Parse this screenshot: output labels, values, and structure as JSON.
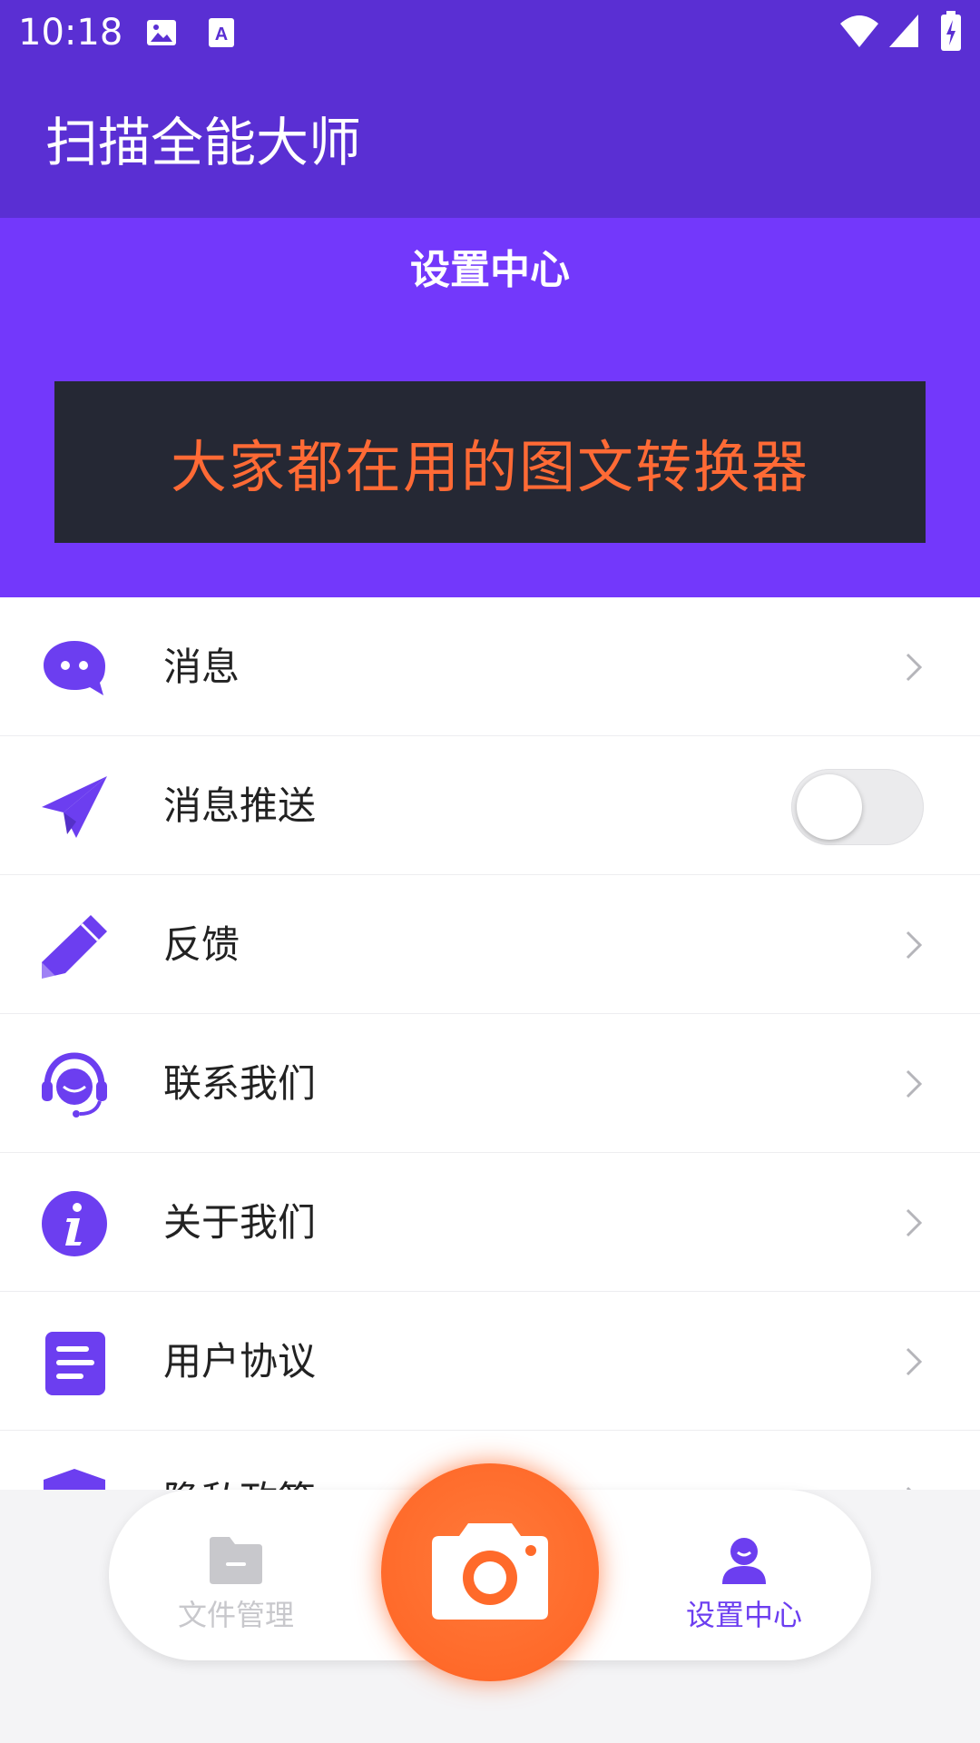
{
  "status_bar": {
    "time": "10:18",
    "left_icons": [
      "image-icon",
      "text-recognition-icon"
    ],
    "right_icons": [
      "wifi-icon",
      "cell-signal-icon",
      "battery-charging-icon"
    ]
  },
  "app_bar": {
    "title": "扫描全能大师"
  },
  "header": {
    "subtitle": "设置中心",
    "banner_text": "大家都在用的图文转换器"
  },
  "settings_items": [
    {
      "label": "消息",
      "icon": "chat-bubble-icon",
      "control": "chevron"
    },
    {
      "label": "消息推送",
      "icon": "paper-plane-icon",
      "control": "toggle",
      "toggle_on": false
    },
    {
      "label": "反馈",
      "icon": "pencil-icon",
      "control": "chevron"
    },
    {
      "label": "联系我们",
      "icon": "customer-service-icon",
      "control": "chevron"
    },
    {
      "label": "关于我们",
      "icon": "info-icon",
      "control": "chevron"
    },
    {
      "label": "用户协议",
      "icon": "document-icon",
      "control": "chevron"
    },
    {
      "label": "隐私政策",
      "icon": "shield-icon",
      "control": "chevron"
    }
  ],
  "bottom_nav": {
    "items": [
      {
        "label": "文件管理",
        "icon": "folder-icon",
        "active": false
      },
      {
        "label": "设置中心",
        "icon": "user-icon",
        "active": true
      }
    ],
    "center_button_icon": "camera-icon"
  },
  "colors": {
    "primary_dark": "#5a2fd3",
    "primary": "#7338fb",
    "icon_purple": "#6c3ef0",
    "accent_orange": "#ff6a2a",
    "banner_bg": "#252834",
    "inactive_nav": "#c8c8cc"
  }
}
